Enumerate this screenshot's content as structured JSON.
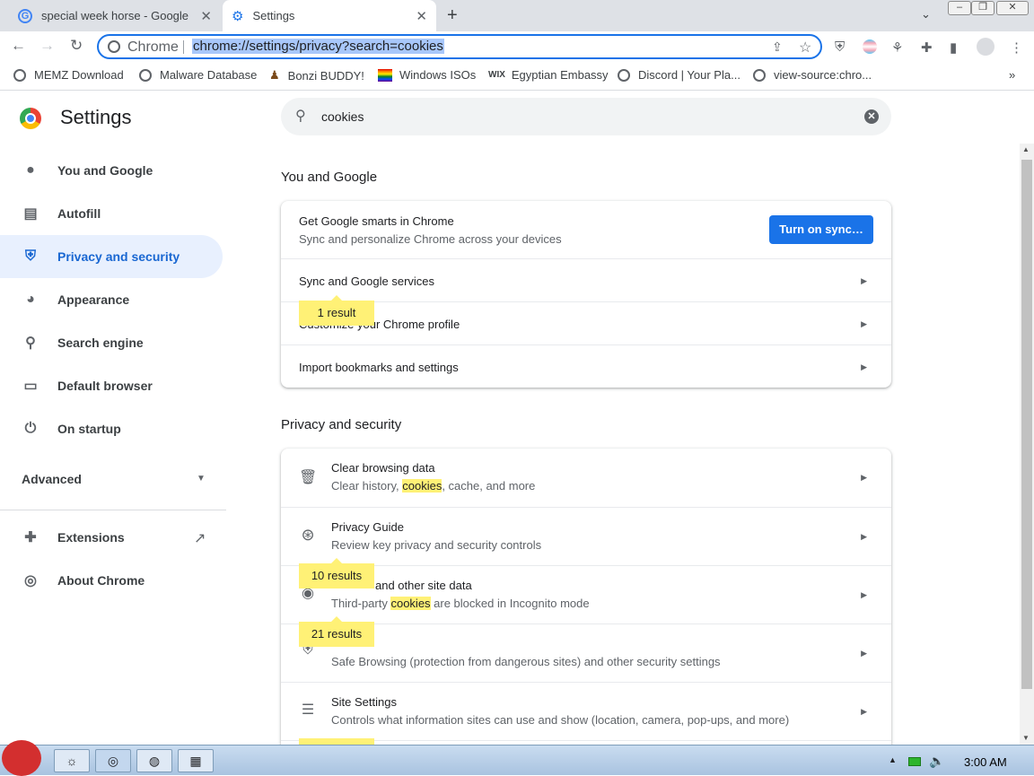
{
  "tabs": [
    {
      "title": "special week horse - Google S"
    },
    {
      "title": "Settings"
    }
  ],
  "toolbar": {
    "omnibox_label": "Chrome",
    "url": "chrome://settings/privacy?search=cookies"
  },
  "bookmarks": [
    "MEMZ Download",
    "Malware Database",
    "Bonzi BUDDY!",
    "Windows ISOs",
    "Egyptian Embassy",
    "Discord | Your Pla...",
    "view-source:chro..."
  ],
  "sidebar": {
    "title": "Settings",
    "items": [
      {
        "label": "You and Google",
        "icon": "person-icon"
      },
      {
        "label": "Autofill",
        "icon": "clipboard-icon"
      },
      {
        "label": "Privacy and security",
        "icon": "shield-icon"
      },
      {
        "label": "Appearance",
        "icon": "palette-icon"
      },
      {
        "label": "Search engine",
        "icon": "search-icon"
      },
      {
        "label": "Default browser",
        "icon": "browser-icon"
      },
      {
        "label": "On startup",
        "icon": "power-icon"
      }
    ],
    "advanced": "Advanced",
    "extensions": "Extensions",
    "about": "About Chrome"
  },
  "search": {
    "value": "cookies"
  },
  "section1": {
    "title": "You and Google",
    "sync_title": "Get Google smarts in Chrome",
    "sync_sub": "Sync and personalize Chrome across your devices",
    "sync_button": "Turn on sync…",
    "rows": [
      "Sync and Google services",
      "Customize your Chrome profile",
      "Import bookmarks and settings"
    ],
    "bubble": "1 result"
  },
  "section2": {
    "title": "Privacy and security",
    "rows": [
      {
        "title": "Clear browsing data",
        "sub_a": "Clear history, ",
        "sub_hl": "cookies",
        "sub_b": ", cache, and more"
      },
      {
        "title": "Privacy Guide",
        "sub": "Review key privacy and security controls"
      },
      {
        "title": "Cookies and other site data",
        "title_visible": "and other site data",
        "sub_a": "Third-party ",
        "sub_hl": "cookies",
        "sub_b": " are blocked in Incognito mode"
      },
      {
        "title": "Security",
        "sub": "Safe Browsing (protection from dangerous sites) and other security settings"
      },
      {
        "title": "Site Settings",
        "sub": "Controls what information sites can use and show (location, camera, pop-ups, and more)"
      }
    ],
    "bubbles": [
      "10 results",
      "21 results"
    ]
  },
  "taskbar": {
    "clock": "3:00 AM"
  },
  "colors": {
    "accent": "#1a73e8",
    "selected_bg": "#e8f0fe",
    "highlight": "#fff176"
  }
}
